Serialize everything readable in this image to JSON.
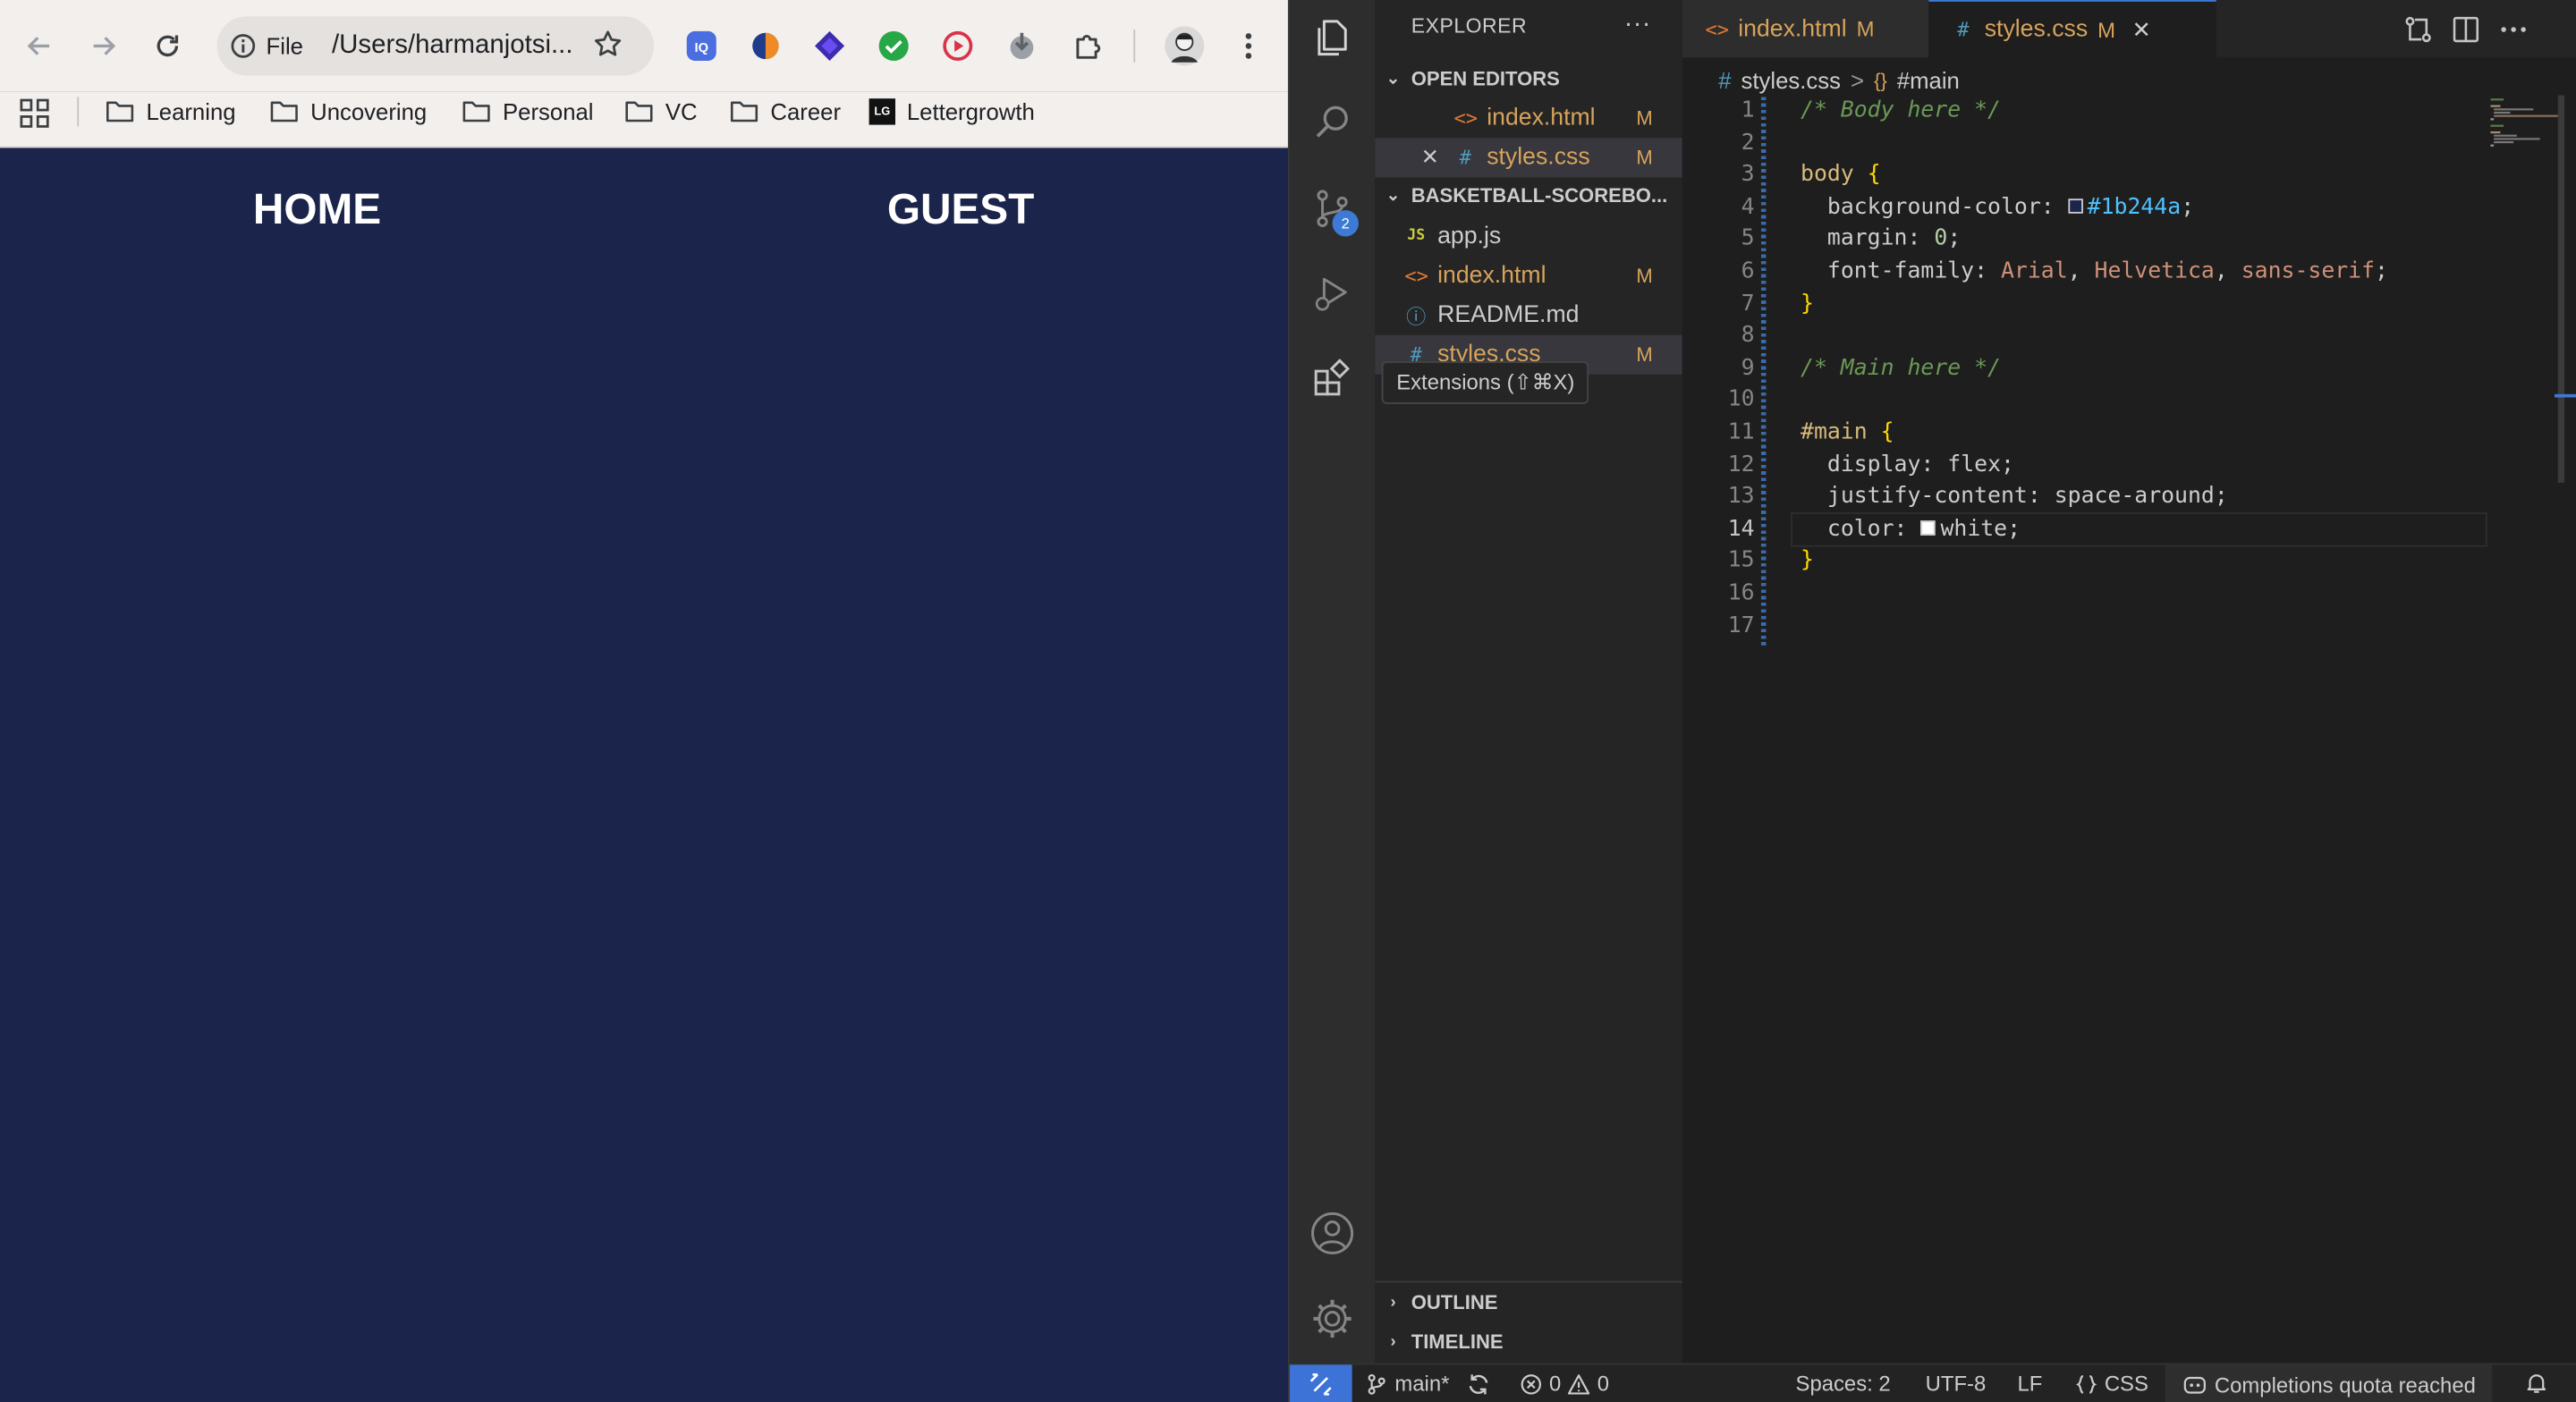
{
  "browser": {
    "omnibox": {
      "scheme_label": "File",
      "url": "/Users/harmanjotsi..."
    },
    "bookmarks": [
      {
        "label": "Learning"
      },
      {
        "label": "Uncovering"
      },
      {
        "label": "Personal"
      },
      {
        "label": "VC"
      },
      {
        "label": "Career"
      },
      {
        "label": "Lettergrowth",
        "icon_text": "LG"
      }
    ],
    "page": {
      "home_label": "HOME",
      "guest_label": "GUEST",
      "background_color": "#1b244a"
    }
  },
  "vscode": {
    "explorer": {
      "title": "EXPLORER",
      "more": "···",
      "open_editors_label": "OPEN EDITORS",
      "open_editors": [
        {
          "icon": "<>",
          "name": "index.html",
          "status": "M"
        },
        {
          "icon": "#",
          "name": "styles.css",
          "status": "M"
        }
      ],
      "project_label": "BASKETBALL-SCOREBO...",
      "files": [
        {
          "icon": "JS",
          "name": "app.js",
          "status": ""
        },
        {
          "icon": "<>",
          "name": "index.html",
          "status": "M"
        },
        {
          "icon": "ⓘ",
          "name": "README.md",
          "status": ""
        },
        {
          "icon": "#",
          "name": "styles.css",
          "status": "M"
        }
      ],
      "outline_label": "OUTLINE",
      "timeline_label": "TIMELINE"
    },
    "tooltip": "Extensions (⇧⌘X)",
    "source_control_badge": "2",
    "tabs": [
      {
        "icon": "<>",
        "label": "index.html",
        "status": "M"
      },
      {
        "icon": "#",
        "label": "styles.css",
        "status": "M"
      }
    ],
    "breadcrumb": {
      "file_icon": "#",
      "file": "styles.css",
      "separator": ">",
      "symbol": "#main"
    },
    "code_lines": [
      {
        "n": "1",
        "text": "/* Body here */"
      },
      {
        "n": "2",
        "text": ""
      },
      {
        "n": "3",
        "text": "body {"
      },
      {
        "n": "4",
        "text": "  background-color: #1b244a;"
      },
      {
        "n": "5",
        "text": "  margin: 0;"
      },
      {
        "n": "6",
        "text": "  font-family: Arial, Helvetica, sans-serif;"
      },
      {
        "n": "7",
        "text": "}"
      },
      {
        "n": "8",
        "text": ""
      },
      {
        "n": "9",
        "text": "/* Main here */"
      },
      {
        "n": "10",
        "text": ""
      },
      {
        "n": "11",
        "text": "#main {"
      },
      {
        "n": "12",
        "text": "  display: flex;"
      },
      {
        "n": "13",
        "text": "  justify-content: space-around;"
      },
      {
        "n": "14",
        "text": "  color: white;"
      },
      {
        "n": "15",
        "text": "}"
      },
      {
        "n": "16",
        "text": ""
      },
      {
        "n": "17",
        "text": ""
      }
    ],
    "active_line": "14",
    "status": {
      "branch": "main*",
      "errors": "0",
      "warnings": "0",
      "spaces": "Spaces: 2",
      "encoding": "UTF-8",
      "eol": "LF",
      "language": "CSS",
      "copilot": "Completions quota reached"
    },
    "colors": {
      "accent": "#3d7ad6",
      "modified": "#d7a35b"
    }
  }
}
